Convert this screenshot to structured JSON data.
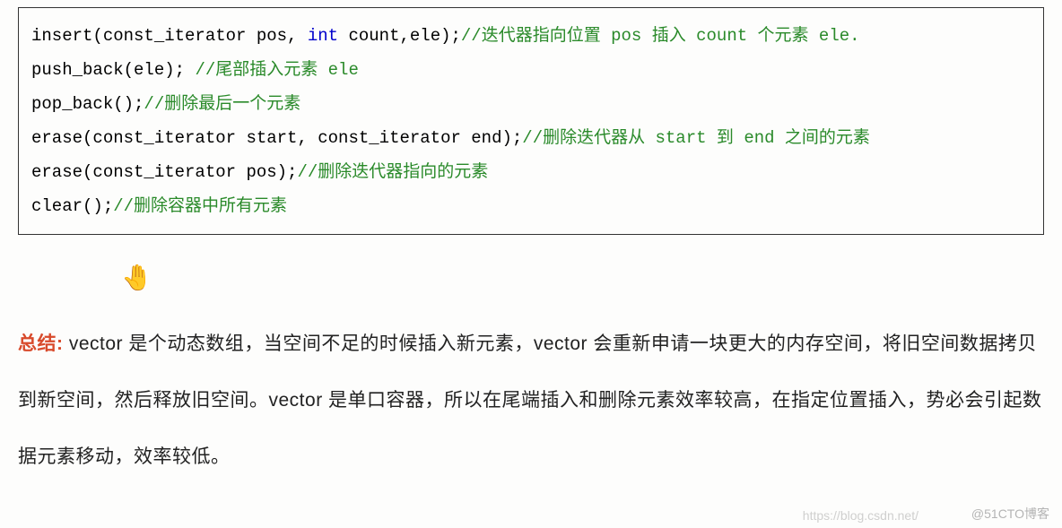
{
  "code": {
    "lines": [
      {
        "pre": "insert(const_iterator pos, ",
        "kw": "int",
        "mid": " count,ele);",
        "comment": "//迭代器指向位置 pos 插入 count 个元素 ele."
      },
      {
        "pre": "push_back(ele); ",
        "kw": "",
        "mid": "",
        "comment": "//尾部插入元素 ele"
      },
      {
        "pre": "pop_back();",
        "kw": "",
        "mid": "",
        "comment": "//删除最后一个元素"
      },
      {
        "pre": "erase(const_iterator start, const_iterator end);",
        "kw": "",
        "mid": "",
        "comment": "//删除迭代器从 start 到 end 之间的元素"
      },
      {
        "pre": "erase(const_iterator pos);",
        "kw": "",
        "mid": "",
        "comment": "//删除迭代器指向的元素"
      },
      {
        "pre": "clear();",
        "kw": "",
        "mid": "",
        "comment": "//删除容器中所有元素"
      }
    ]
  },
  "cursor_glyph": "✋",
  "summary": {
    "label": "总结:",
    "text_part1": " vector 是个动态数组，当空间不足的时候插入新元素，vector 会重新申请一块更大的内存空间，将旧空间数据拷贝到新空间，然后释放旧空间。vector 是单口容器，所以在尾端插入和删除元素效率较高，在指定位置插入，势必会引起数据元素移动，效率较低。"
  },
  "watermark": {
    "left": "https://blog.csdn.net/",
    "right": "@51CTO博客"
  }
}
